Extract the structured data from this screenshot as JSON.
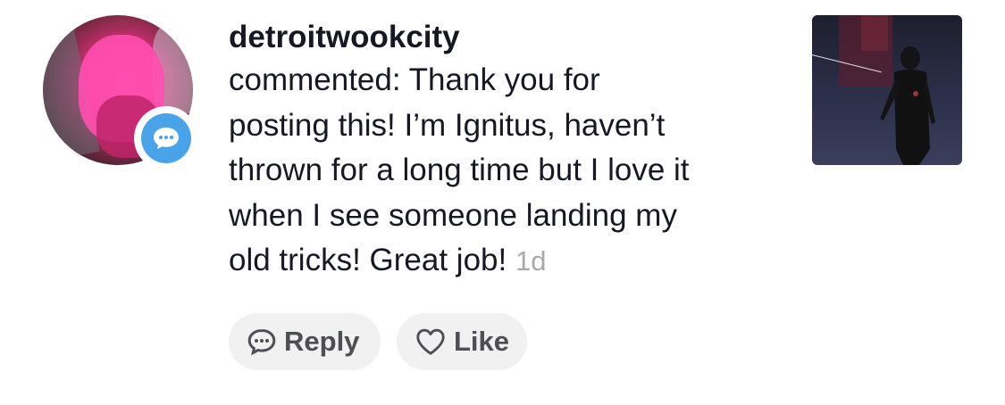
{
  "comment": {
    "username": "detroitwookcity",
    "lines": [
      "commented: Thank you for",
      "posting this! I’m Ignitus, haven’t",
      "thrown for a long time but I love it",
      "when I see someone landing my",
      "old tricks! Great job!"
    ],
    "time": "1d",
    "badge_icon": "chat-bubble-icon",
    "badge_color": "#4aa3e8"
  },
  "actions": {
    "reply_label": "Reply",
    "reply_icon": "chat-bubble-icon",
    "like_label": "Like",
    "like_icon": "heart-outline-icon"
  }
}
